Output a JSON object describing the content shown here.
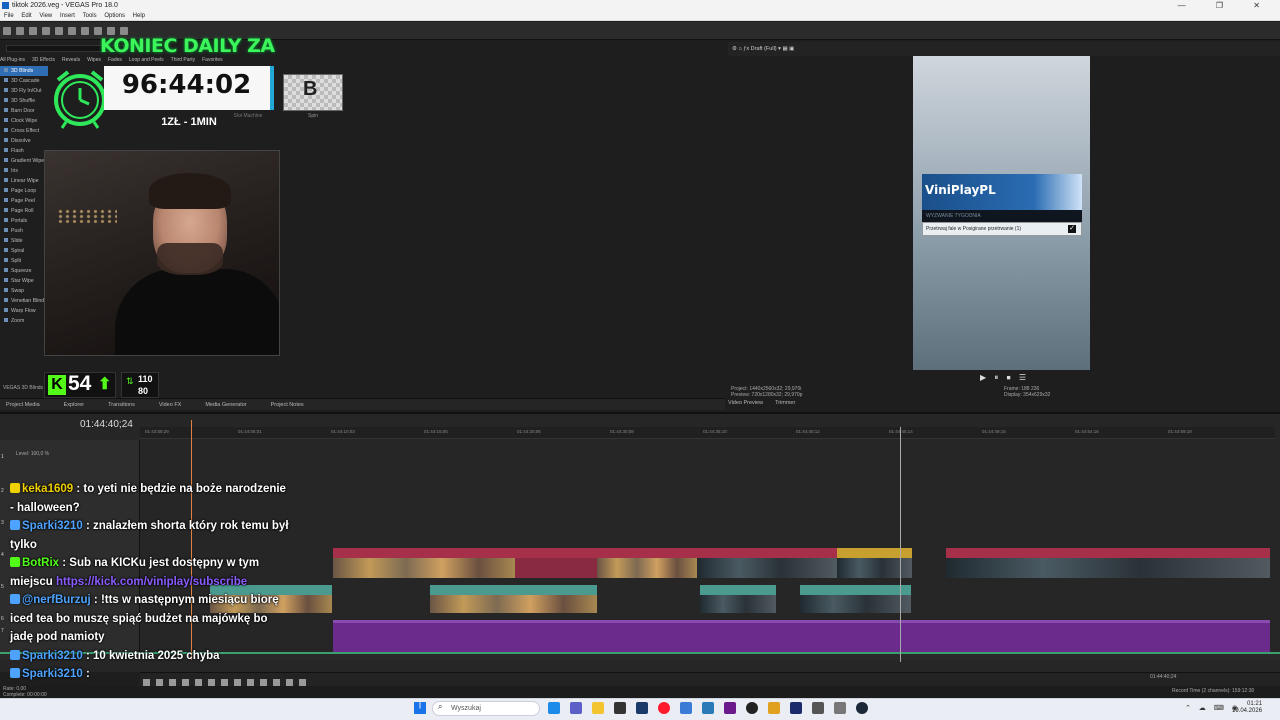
{
  "window": {
    "title": "tiktok 2026.veg - VEGAS Pro 18.0"
  },
  "menu": [
    "File",
    "Edit",
    "View",
    "Insert",
    "Tools",
    "Options",
    "Help"
  ],
  "plugins": {
    "tabs": [
      "All Plug-ins",
      "3D Effects",
      "Reveals",
      "Wipes",
      "Fades",
      "Loop and Peels",
      "Third Party",
      "Favorites"
    ],
    "items": [
      "3D Blinds",
      "3D Cascade",
      "3D Fly In/Out",
      "3D Shuffle",
      "Barn Door",
      "Clock Wipe",
      "Cross Effect",
      "Dissolve",
      "Flash",
      "Gradient Wipe",
      "Iris",
      "Linear Wipe",
      "Page Loop",
      "Page Peel",
      "Page Roll",
      "Portals",
      "Push",
      "Slide",
      "Spiral",
      "Split",
      "Squeeze",
      "Star Wipe",
      "Swap",
      "Venetian Blinds",
      "Warp Flow",
      "Zoom"
    ],
    "selected": "3D Blinds",
    "footer": "VEGAS 3D Blinds"
  },
  "overlay": {
    "koniec": "KONIEC DAILY ZA",
    "timer": "96:44:02",
    "rate": "1ZŁ - 1MIN",
    "spin_label": "Spin",
    "slot_label": "Slot Machine",
    "spin_letter": "B",
    "kick_count": "54",
    "votes_up": "110",
    "votes_down": "80"
  },
  "left_tabs": [
    "Project Media",
    "Explorer",
    "Transitions",
    "Video FX",
    "Media Generator",
    "Project Notes"
  ],
  "preview": {
    "toolbar_label": "Draft (Full)",
    "brand": "ViniPlayPL",
    "subtitle": "WYZWANIE TYGODNIA",
    "checkbox_text": "Przetrwaj fale w Posigirane przetrwanie (1)",
    "checkbox_mark": "✓",
    "project_info": [
      "Project: 1440x2560x32; 29,970i",
      "Preview: 720x1280x32; 29,970p",
      "Display: 354x629x32"
    ],
    "frame_info": [
      "Frame: 188 236",
      "Display: 354x629x32"
    ],
    "tabs": [
      "Video Preview",
      "Trimmer"
    ]
  },
  "timeline": {
    "current_time": "01:44:40;24",
    "level": "Level: 100,0 %",
    "ruler_ticks": [
      "01:43:59;29",
      "01:44:05;01",
      "01:44:10;03",
      "01:44:15;05",
      "01:44:20;06",
      "01:44:30;08",
      "01:44:35;10",
      "01:44:40;12",
      "01:44:45;14",
      "01:44:49;15",
      "01:44:54;16",
      "01:44:59;18"
    ],
    "track_numbers": [
      "1",
      "2",
      "3",
      "4",
      "5",
      "6",
      "7",
      "8"
    ],
    "record_time": "Record Time (2 channels): 159:12:30",
    "end_time": "01:44:40;24",
    "rate_label": "Rate: 0,00",
    "complete": "Complete: 00:00:00"
  },
  "chat": [
    {
      "user": "keka1609",
      "color": "#f0d000",
      "text": " : to yeti nie będzie na boże narodzenie - halloween?"
    },
    {
      "user": "Sparki3210",
      "color": "#4da3ff",
      "text": " : znalazłem shorta który rok temu był tylko"
    },
    {
      "user": "BotRix",
      "color": "#53fc18",
      "text": " : Sub na KICKu jest dostępny w tym miejscu ",
      "link": "https://kick.com/viniplay/subscribe"
    },
    {
      "user": "@nerfBurzuj",
      "color": "#4da3ff",
      "text": " : !tts w następnym miesiącu biorę iced tea bo muszę spiąć budżet na majówkę bo jadę pod namioty"
    },
    {
      "user": "Sparki3210",
      "color": "#4da3ff",
      "text": " : 10 kwietnia 2025 chyba"
    },
    {
      "user": "Sparki3210",
      "color": "#4da3ff",
      "text": " : "
    },
    {
      "user": "Sparki3210",
      "color": "#4da3ff",
      "text": ""
    }
  ],
  "taskbar": {
    "search_placeholder": "Wyszukaj",
    "time": "01:21",
    "date": "19.04.2026"
  },
  "colors": {
    "kick_green": "#53fc18",
    "audio_purple": "#6a2b8c",
    "clip_red": "#a6304a",
    "clip_teal": "#4a9a90"
  }
}
